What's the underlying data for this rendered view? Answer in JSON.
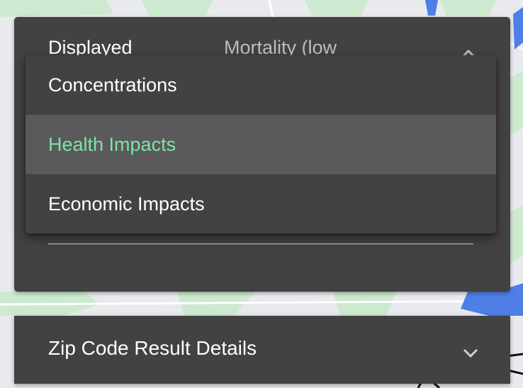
{
  "settings_panel": {
    "label": "Displayed",
    "value": "Mortality (low"
  },
  "menu": {
    "items": [
      {
        "label": "Concentrations",
        "selected": false
      },
      {
        "label": "Health Impacts",
        "selected": true
      },
      {
        "label": "Economic Impacts",
        "selected": false
      }
    ]
  },
  "details_panel": {
    "title": "Zip Code Result Details"
  },
  "colors": {
    "panel": "#424242",
    "selected_item_bg": "#5a5a5a",
    "selected_item_text": "#7ee3a6",
    "map_park": "#cde9cf",
    "map_water": "#4e7ee6"
  },
  "icons": {
    "panel_toggle": "chevron-up-icon",
    "details_toggle": "chevron-down-icon"
  }
}
